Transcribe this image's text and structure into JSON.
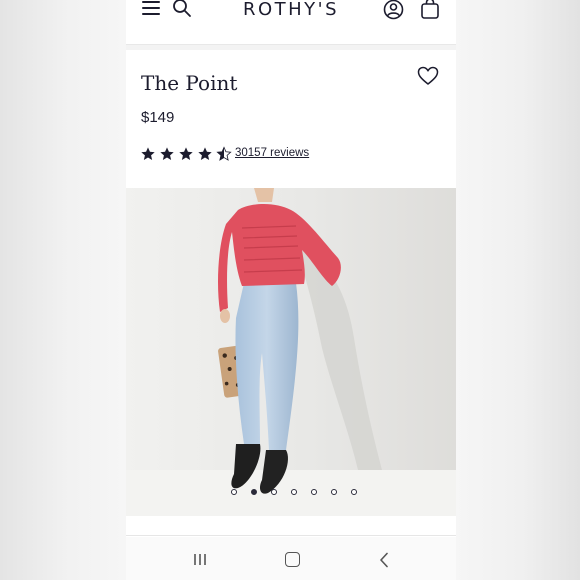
{
  "header": {
    "brand": "ROTHY'S",
    "icons": [
      "menu-icon",
      "search-icon",
      "account-icon",
      "shopping-bag-icon"
    ]
  },
  "product": {
    "name": "The Point",
    "price": "$149",
    "rating": 4.5,
    "rating_max": 5,
    "reviews_label": "30157 reviews",
    "favorite_icon": "heart-outline-icon"
  },
  "gallery": {
    "image_count": 7,
    "active_index": 1
  },
  "system_nav": {
    "icons": [
      "recent-apps-icon",
      "home-icon",
      "back-icon"
    ]
  },
  "colors": {
    "brand_navy": "#1c1c2e",
    "blouse_pink": "#e0505f",
    "background": "#ffffff"
  }
}
